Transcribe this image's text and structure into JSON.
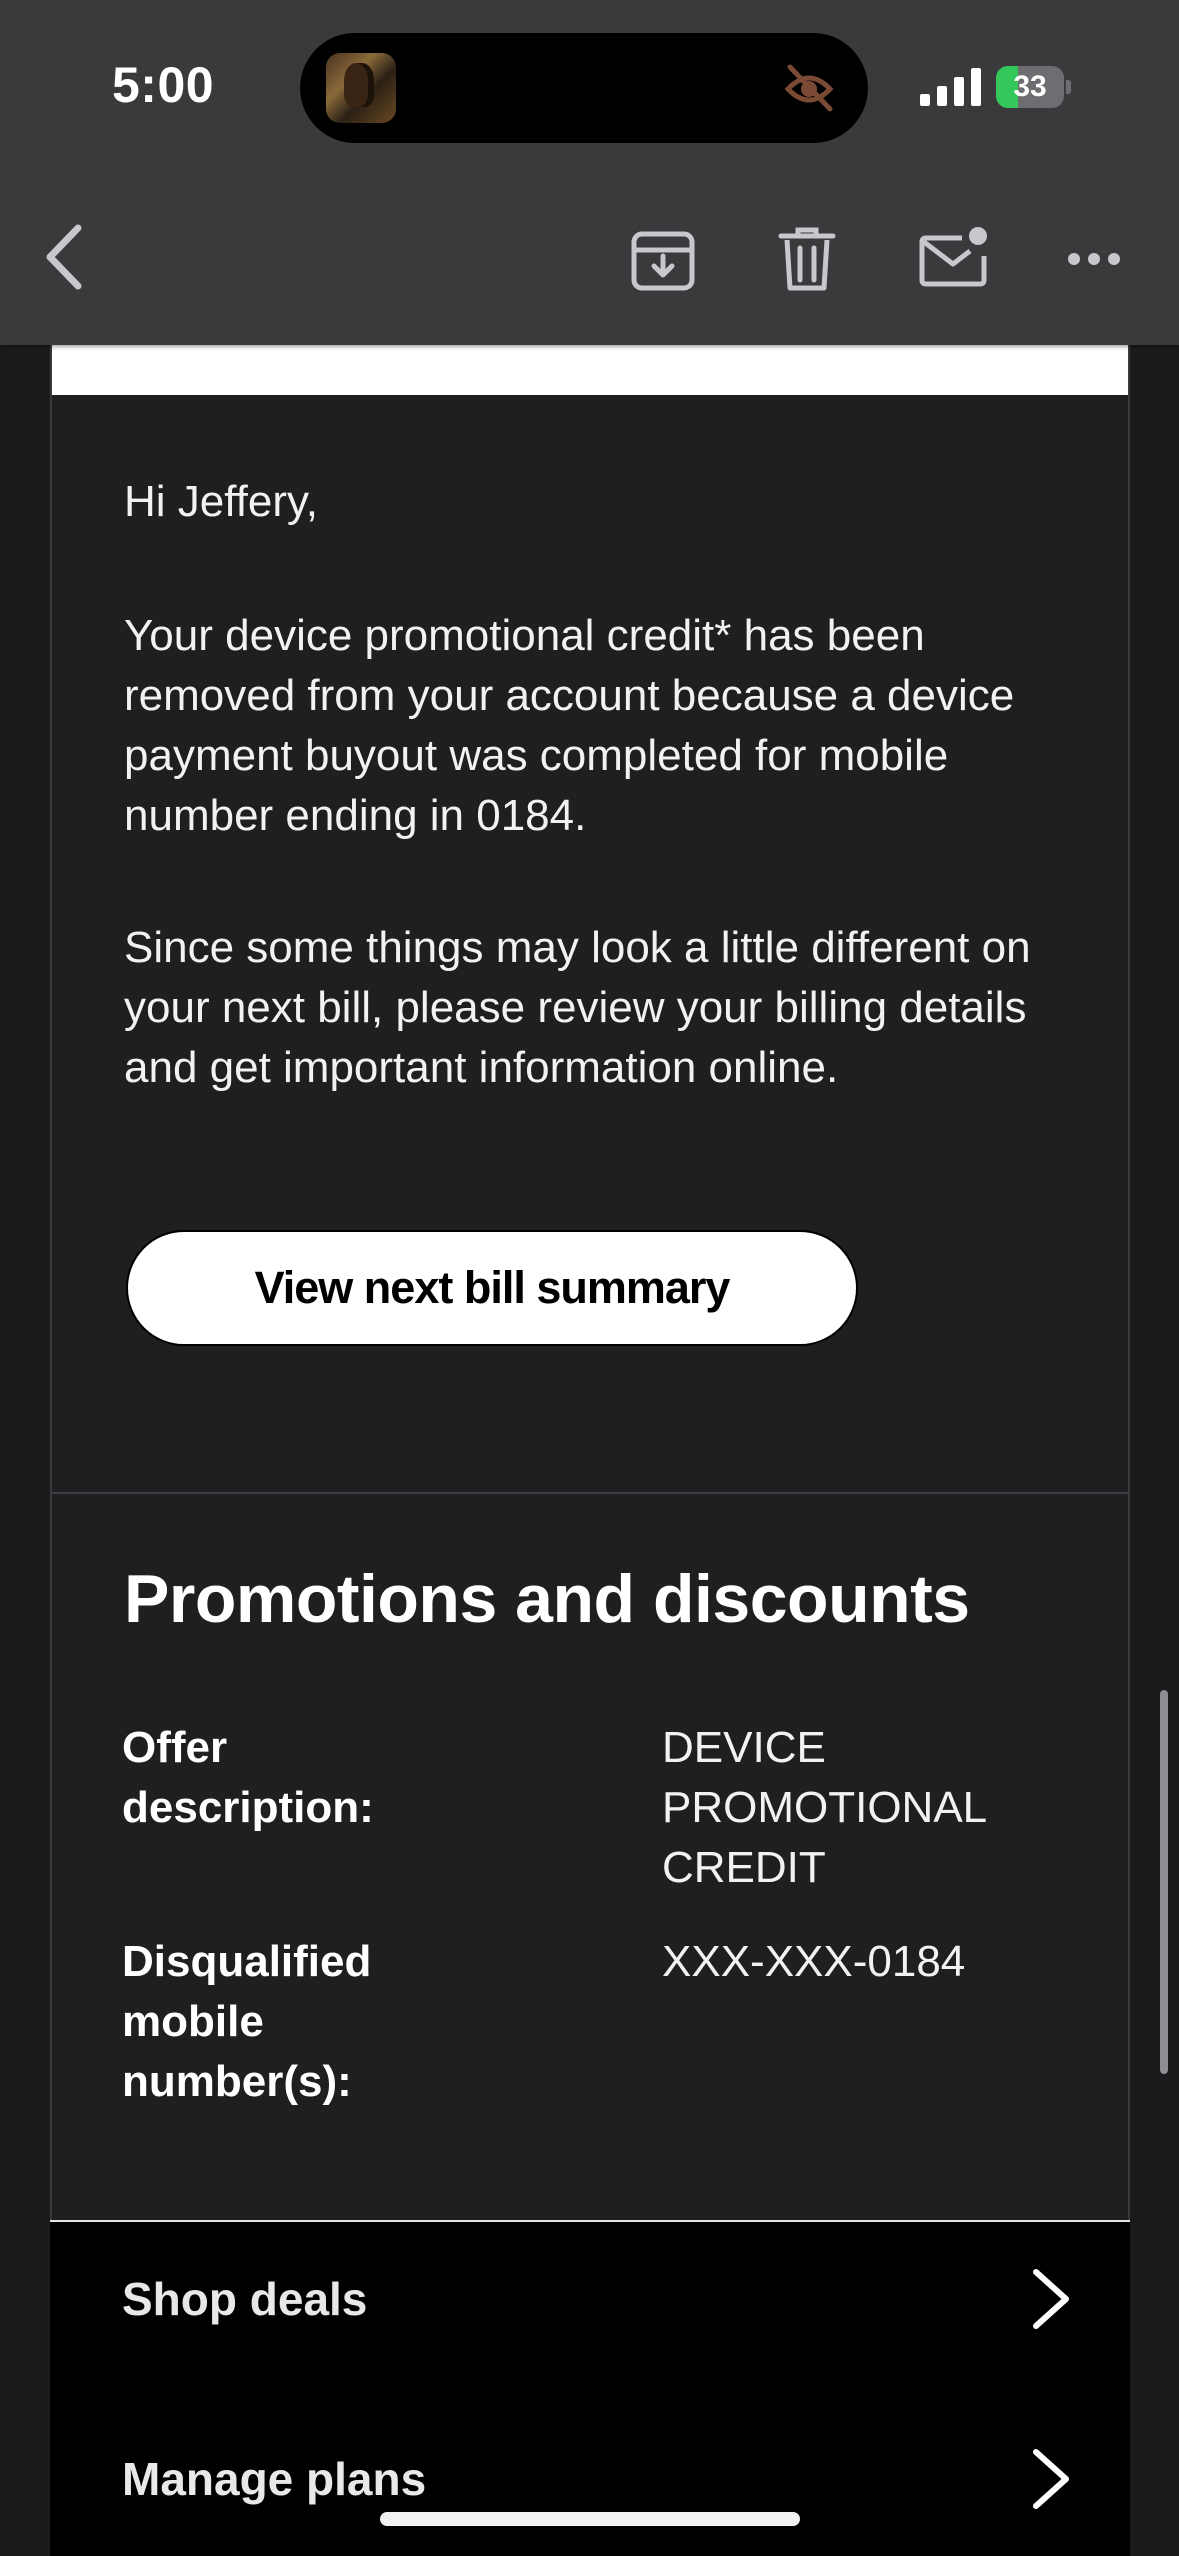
{
  "status_bar": {
    "time": "5:00",
    "battery_percent": "33",
    "battery_level": 0.33,
    "charging": true,
    "icons": [
      "signal-icon",
      "battery-icon",
      "mute-icon"
    ]
  },
  "toolbar": {
    "icons": [
      "back-chevron-icon",
      "archive-icon",
      "trash-icon",
      "mail-unread-icon",
      "more-icon"
    ]
  },
  "email": {
    "greeting": "Hi Jeffery,",
    "paragraph1": "Your device promotional credit* has been removed from your account because a device payment buyout was completed for mobile number ending in 0184.",
    "paragraph2": "Since some things may look a little different on your next bill, please review your billing details and get important information online.",
    "cta_label": "View next bill summary",
    "promotions": {
      "heading": "Promotions and discounts",
      "rows": [
        {
          "label": "Offer description:",
          "value": "DEVICE PROMOTIONAL CREDIT"
        },
        {
          "label": "Disqualified mobile number(s):",
          "value": "XXX-XXX-0184"
        }
      ]
    },
    "nav_links": [
      {
        "label": "Shop deals"
      },
      {
        "label": "Manage plans"
      }
    ]
  },
  "colors": {
    "background": "#1b1b1d",
    "toolbar": "#3a3a3c",
    "battery_green": "#34c759",
    "button_bg": "#ffffff"
  }
}
